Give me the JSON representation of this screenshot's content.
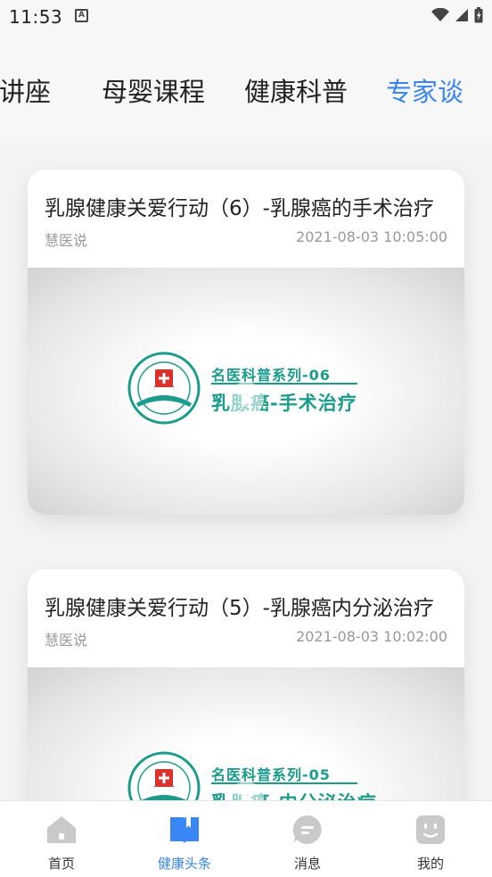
{
  "status_bar": {
    "time": "11:53",
    "notification_badge": "A"
  },
  "tabs": {
    "items": [
      {
        "label": "益讲座",
        "active": false
      },
      {
        "label": "母婴课程",
        "active": false
      },
      {
        "label": "健康科普",
        "active": false
      },
      {
        "label": "专家谈",
        "active": true
      }
    ]
  },
  "articles": [
    {
      "title": "乳腺健康关爱行动（6）-乳腺癌的手术治疗",
      "source": "慧医说",
      "time": "2021-08-03 10:05:00",
      "thumb_series": "名医科普系列-06",
      "thumb_topic": "乳腺癌-手术治疗"
    },
    {
      "title": "乳腺健康关爱行动（5）-乳腺癌内分泌治疗",
      "source": "慧医说",
      "time": "2021-08-03 10:02:00",
      "thumb_series": "名医科普系列-05",
      "thumb_topic": "乳腺癌-内分泌治疗"
    }
  ],
  "bottom_nav": {
    "items": [
      {
        "label": "首页",
        "icon": "home-icon",
        "active": false
      },
      {
        "label": "健康头条",
        "icon": "book-icon",
        "active": true
      },
      {
        "label": "消息",
        "icon": "message-icon",
        "active": false
      },
      {
        "label": "我的",
        "icon": "profile-icon",
        "active": false
      }
    ]
  },
  "colors": {
    "accent": "#3a86f5",
    "teal": "#1a9c8c",
    "inactive_icon": "#c9c9c9"
  }
}
